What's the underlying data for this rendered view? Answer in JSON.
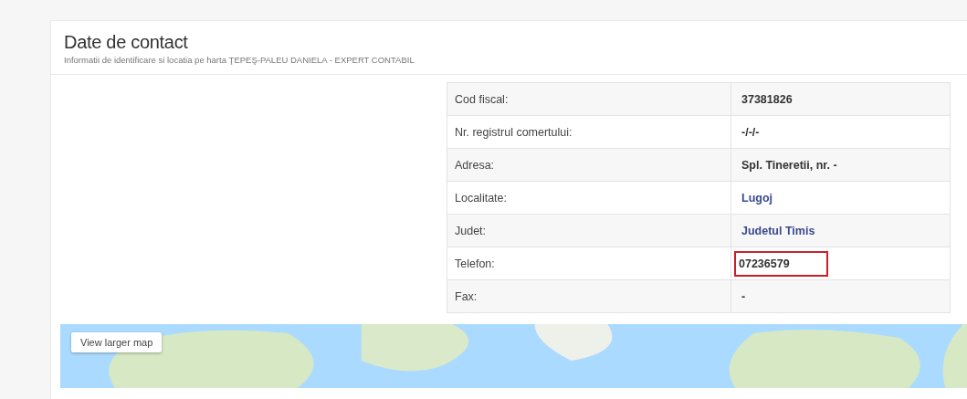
{
  "section": {
    "title": "Date de contact",
    "subtitle": "Informatii de identificare si locatia pe harta ŢEPEŞ-PALEU DANIELA - EXPERT CONTABIL"
  },
  "details": [
    {
      "label": "Cod fiscal:",
      "value": "37381826",
      "kind": "text"
    },
    {
      "label": "Nr. registrul comertului:",
      "value": "-/-/-",
      "kind": "text"
    },
    {
      "label": "Adresa:",
      "value": "Spl. Tineretii, nr. -",
      "kind": "text"
    },
    {
      "label": "Localitate:",
      "value": "Lugoj",
      "kind": "link"
    },
    {
      "label": "Judet:",
      "value": "Judetul Timis",
      "kind": "link"
    },
    {
      "label": "Telefon:",
      "value": "07236579",
      "kind": "highlighted"
    },
    {
      "label": "Fax:",
      "value": "-",
      "kind": "text"
    }
  ],
  "map": {
    "button": "View larger map"
  }
}
